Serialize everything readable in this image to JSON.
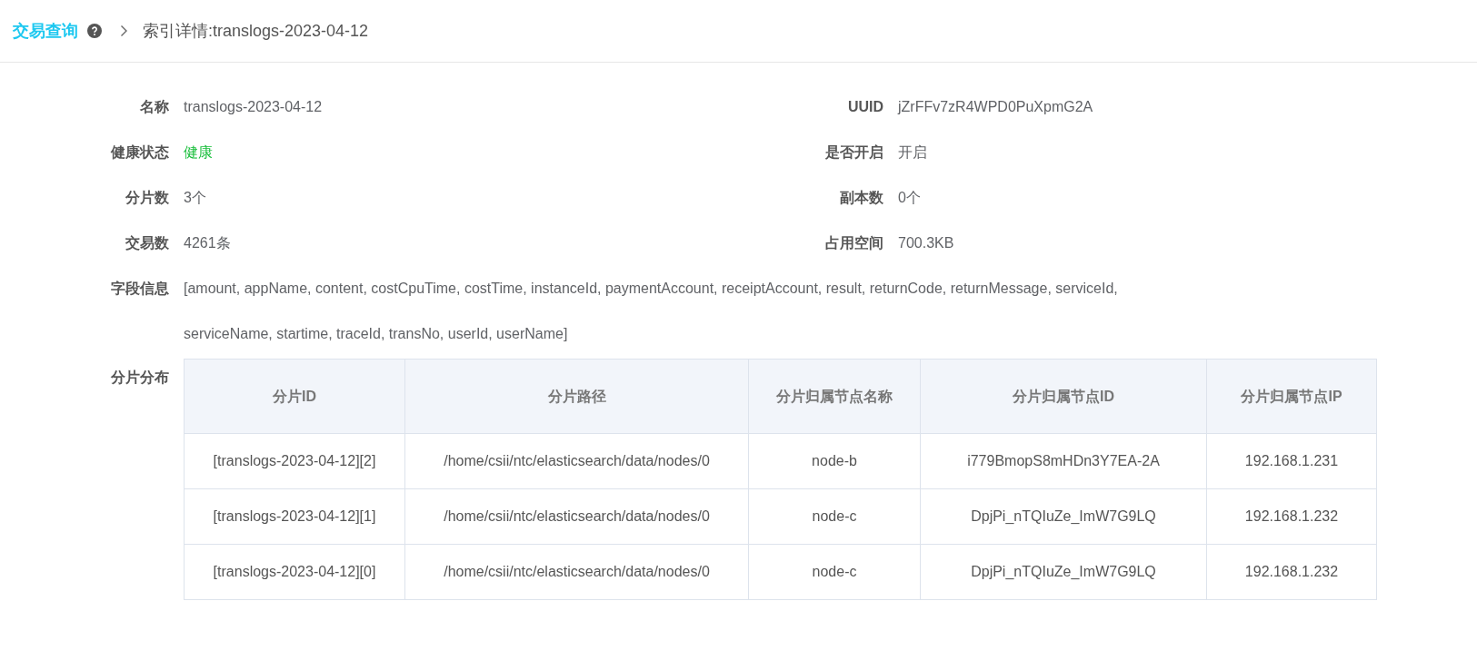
{
  "breadcrumb": {
    "root": "交易查询",
    "current": "索引详情:translogs-2023-04-12"
  },
  "details": [
    {
      "label": "名称",
      "value": "translogs-2023-04-12"
    },
    {
      "label": "UUID",
      "value": "jZrFFv7zR4WPD0PuXpmG2A"
    },
    {
      "label": "健康状态",
      "value": "健康",
      "color": "#19be3b"
    },
    {
      "label": "是否开启",
      "value": "开启"
    },
    {
      "label": "分片数",
      "value": "3个"
    },
    {
      "label": "副本数",
      "value": "0个"
    },
    {
      "label": "交易数",
      "value": "4261条"
    },
    {
      "label": "占用空间",
      "value": "700.3KB"
    }
  ],
  "fields": {
    "label": "字段信息",
    "value": "[amount, appName, content, costCpuTime, costTime, instanceId, paymentAccount, receiptAccount, result, returnCode, returnMessage, serviceId, serviceName, startime, traceId, transNo, userId, userName]"
  },
  "shards": {
    "label": "分片分布",
    "columns": [
      "分片ID",
      "分片路径",
      "分片归属节点名称",
      "分片归属节点ID",
      "分片归属节点IP"
    ],
    "rows": [
      [
        "[translogs-2023-04-12][2]",
        "/home/csii/ntc/elasticsearch/data/nodes/0",
        "node-b",
        "i779BmopS8mHDn3Y7EA-2A",
        "192.168.1.231"
      ],
      [
        "[translogs-2023-04-12][1]",
        "/home/csii/ntc/elasticsearch/data/nodes/0",
        "node-c",
        "DpjPi_nTQIuZe_ImW7G9LQ",
        "192.168.1.232"
      ],
      [
        "[translogs-2023-04-12][0]",
        "/home/csii/ntc/elasticsearch/data/nodes/0",
        "node-c",
        "DpjPi_nTQIuZe_ImW7G9LQ",
        "192.168.1.232"
      ]
    ]
  }
}
